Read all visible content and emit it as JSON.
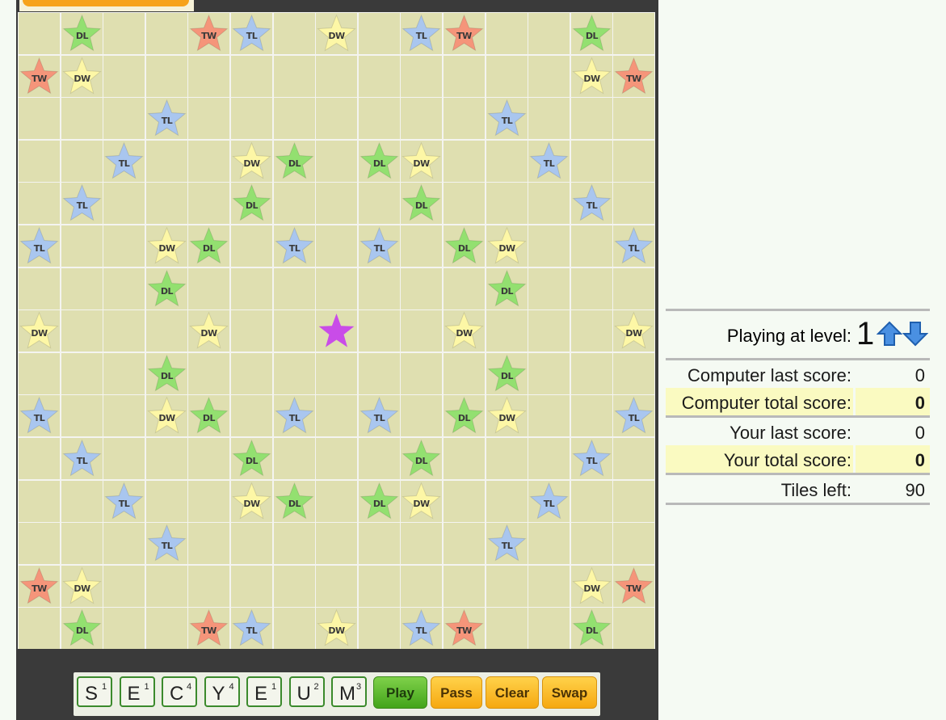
{
  "colors": {
    "TW": "#f5957a",
    "DW": "#fdf7a6",
    "DL": "#93e070",
    "TL": "#a9c6ef",
    "center": "#c94ce8",
    "cell": "#dfdfb0",
    "rack_border": "#3b8a2c"
  },
  "premium_labels": {
    "TW": "TW",
    "DW": "DW",
    "DL": "DL",
    "TL": "TL"
  },
  "board": {
    "size": 15,
    "center": [
      7,
      7
    ],
    "rows": [
      "-D--TT-W-TT--D-",
      "TW-----------WT",
      "---T-------T---",
      "--T-WD-DW---T--",
      "-T---D---D---T-",
      "T--WD--T-T-DW--T",
      "---D-------D---",
      "W---W--*--W---W",
      "---D-------D---",
      "T--WD--T-T-DW--T",
      "-T---D---D---T-",
      "--T-WD-DW---T--",
      "---T-------T---",
      "TW-----------WT",
      "-D--TT-W-TT--D-"
    ]
  },
  "rack": [
    {
      "letter": "S",
      "points": "1"
    },
    {
      "letter": "E",
      "points": "1"
    },
    {
      "letter": "C",
      "points": "4"
    },
    {
      "letter": "Y",
      "points": "4"
    },
    {
      "letter": "E",
      "points": "1"
    },
    {
      "letter": "U",
      "points": "2"
    },
    {
      "letter": "M",
      "points": "3"
    }
  ],
  "buttons": {
    "play": "Play",
    "pass": "Pass",
    "clear": "Clear",
    "swap": "Swap"
  },
  "scores": {
    "level_label": "Playing at level:",
    "level": "1",
    "computer_last_label": "Computer last score:",
    "computer_last": "0",
    "computer_total_label": "Computer total score:",
    "computer_total": "0",
    "your_last_label": "Your last score:",
    "your_last": "0",
    "your_total_label": "Your total score:",
    "your_total": "0",
    "tiles_left_label": "Tiles left:",
    "tiles_left": "90"
  }
}
